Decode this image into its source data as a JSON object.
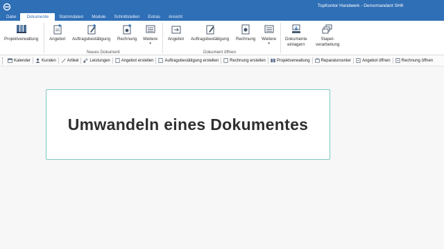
{
  "titlebar": {
    "window_title": "TopKontor Handwerk - Demomandant SHK",
    "tabs": [
      {
        "label": "Datei",
        "active": false
      },
      {
        "label": "Dokumente",
        "active": true
      },
      {
        "label": "Stammdaten",
        "active": false
      },
      {
        "label": "Module",
        "active": false
      },
      {
        "label": "Schnittstellen",
        "active": false
      },
      {
        "label": "Extras",
        "active": false
      },
      {
        "label": "Ansicht",
        "active": false
      }
    ]
  },
  "ribbon": {
    "projektverwaltung": "Projektverwaltung",
    "neues_dokument": {
      "group_label": "Neues Dokument",
      "angebot": "Angebot",
      "auftrag": "Auftragsbestätigung",
      "rechnung": "Rechnung",
      "weitere": "Weitere"
    },
    "dokument_oeffnen": {
      "group_label": "Dokument öffnen",
      "angebot": "Angebot",
      "auftrag": "Auftragsbestätigung",
      "rechnung": "Rechnung",
      "weitere": "Weitere"
    },
    "einlagern_line1": "Dokumente",
    "einlagern_line2": "einlagern",
    "stapel_line1": "Stapel-",
    "stapel_line2": "verarbeitung"
  },
  "quickbar": {
    "items": [
      {
        "label": "Kalender",
        "icon": "calendar-icon"
      },
      {
        "label": "Kunden",
        "icon": "person-icon"
      },
      {
        "label": "Artikel",
        "icon": "tools-icon"
      },
      {
        "label": "Leistungen",
        "icon": "wrench-icon"
      },
      {
        "label": "Angebot erstellen",
        "icon": "document-new-icon"
      },
      {
        "label": "Auftragsbestätigung erstellen",
        "icon": "document-new-icon"
      },
      {
        "label": "Rechnung erstellen",
        "icon": "document-new-icon"
      },
      {
        "label": "Projektverwaltung",
        "icon": "projects-icon"
      },
      {
        "label": "Reparaturcenter",
        "icon": "repair-icon"
      },
      {
        "label": "Angebot öffnen",
        "icon": "document-open-icon"
      },
      {
        "label": "Rechnung öffnen",
        "icon": "document-open-icon"
      }
    ]
  },
  "content": {
    "heading": "Umwandeln eines Dokumentes"
  },
  "colors": {
    "titlebar": "#2f6fb6",
    "card_border": "#7cc7c5",
    "heading": "#2f2f2f"
  }
}
